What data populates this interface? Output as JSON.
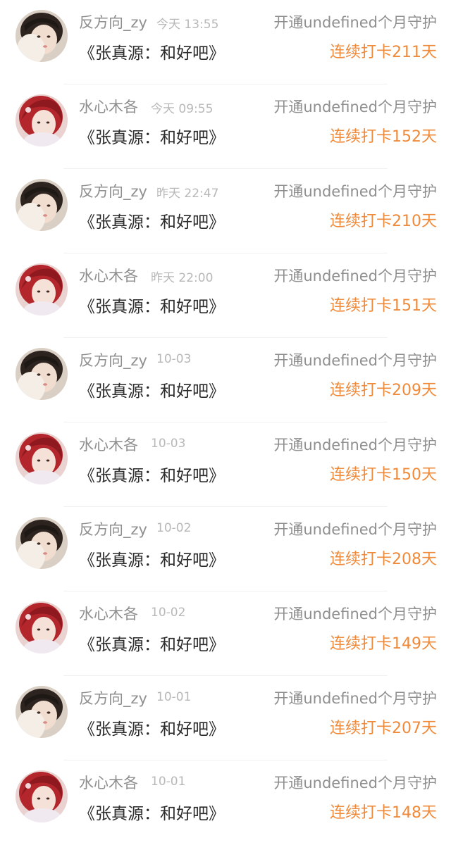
{
  "colors": {
    "name": "#8f8f8f",
    "time": "#b8b8b8",
    "song": "#2b2b2b",
    "streak": "#ef8a3a"
  },
  "items": [
    {
      "user": "反方向_zy",
      "time": "今天 13:55",
      "song": "《张真源：和好吧》",
      "action": "开通undefined个月守护",
      "streak": "连续打卡211天",
      "avatar": "user-a-avatar"
    },
    {
      "user": "水心木各",
      "time": "今天 09:55",
      "song": "《张真源：和好吧》",
      "action": "开通undefined个月守护",
      "streak": "连续打卡152天",
      "avatar": "user-b-avatar"
    },
    {
      "user": "反方向_zy",
      "time": "昨天 22:47",
      "song": "《张真源：和好吧》",
      "action": "开通undefined个月守护",
      "streak": "连续打卡210天",
      "avatar": "user-a-avatar"
    },
    {
      "user": "水心木各",
      "time": "昨天 22:00",
      "song": "《张真源：和好吧》",
      "action": "开通undefined个月守护",
      "streak": "连续打卡151天",
      "avatar": "user-b-avatar"
    },
    {
      "user": "反方向_zy",
      "time": "10-03",
      "song": "《张真源：和好吧》",
      "action": "开通undefined个月守护",
      "streak": "连续打卡209天",
      "avatar": "user-a-avatar"
    },
    {
      "user": "水心木各",
      "time": "10-03",
      "song": "《张真源：和好吧》",
      "action": "开通undefined个月守护",
      "streak": "连续打卡150天",
      "avatar": "user-b-avatar"
    },
    {
      "user": "反方向_zy",
      "time": "10-02",
      "song": "《张真源：和好吧》",
      "action": "开通undefined个月守护",
      "streak": "连续打卡208天",
      "avatar": "user-a-avatar"
    },
    {
      "user": "水心木各",
      "time": "10-02",
      "song": "《张真源：和好吧》",
      "action": "开通undefined个月守护",
      "streak": "连续打卡149天",
      "avatar": "user-b-avatar"
    },
    {
      "user": "反方向_zy",
      "time": "10-01",
      "song": "《张真源：和好吧》",
      "action": "开通undefined个月守护",
      "streak": "连续打卡207天",
      "avatar": "user-a-avatar"
    },
    {
      "user": "水心木各",
      "time": "10-01",
      "song": "《张真源：和好吧》",
      "action": "开通undefined个月守护",
      "streak": "连续打卡148天",
      "avatar": "user-b-avatar"
    }
  ]
}
